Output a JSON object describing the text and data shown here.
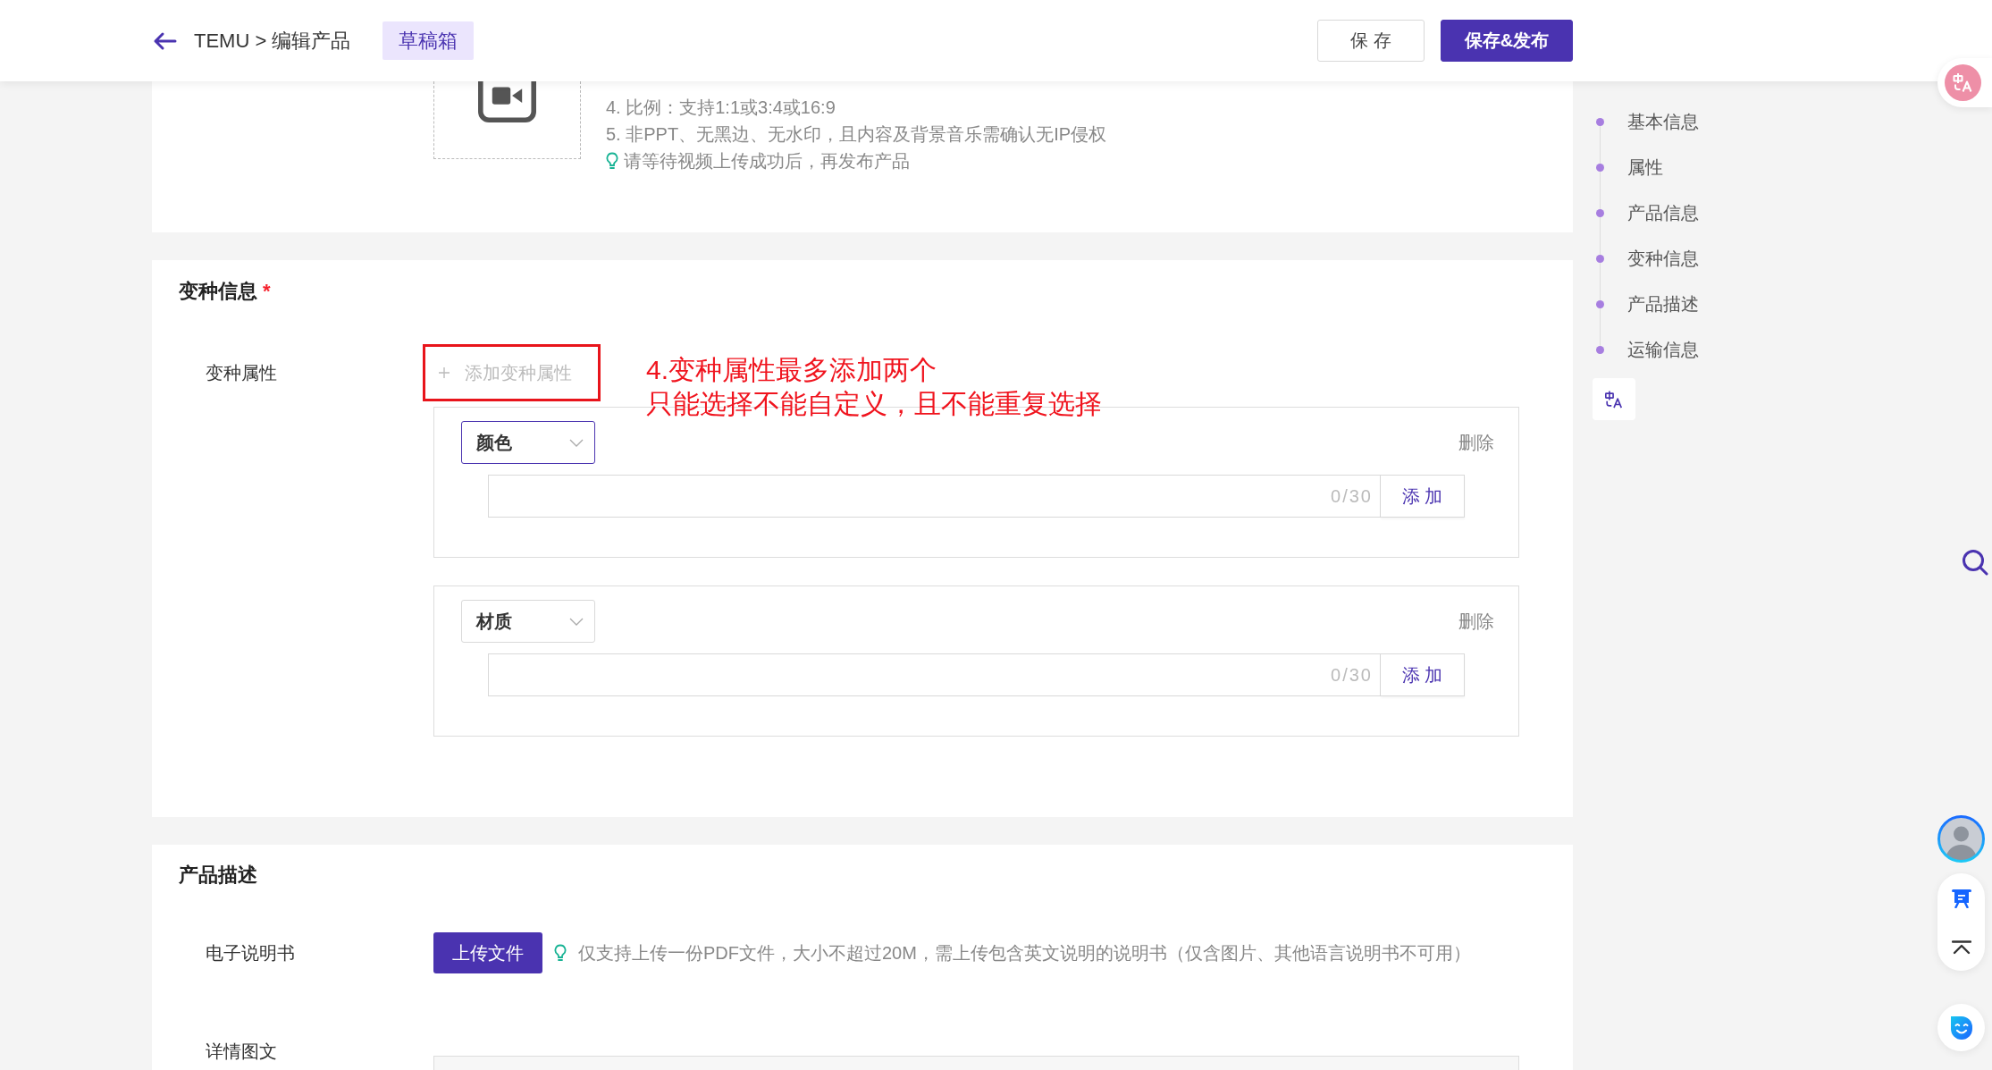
{
  "header": {
    "breadcrumb": "TEMU > 编辑产品",
    "badge": "草稿箱",
    "buttons": [
      {
        "label": "保 存",
        "kind": "secondary"
      },
      {
        "label": "保存&发布",
        "kind": "primary"
      }
    ]
  },
  "video_section": {
    "requirements": [
      "4. 比例：支持1:1或3:4或16:9",
      "5. 非PPT、无黑边、无水印，且内容及背景音乐需确认无IP侵权"
    ],
    "tip": "请等待视频上传成功后，再发布产品"
  },
  "variant_section": {
    "title": "变种信息",
    "required_mark": "*",
    "field_label": "变种属性",
    "add_button": "添加变种属性",
    "annotation": [
      "4.变种属性最多添加两个",
      "只能选择不能自定义，且不能重复选择"
    ],
    "variants": [
      {
        "attribute": "颜色",
        "focused": true,
        "delete": "删除",
        "counter": "0/30",
        "add_button": "添 加"
      },
      {
        "attribute": "材质",
        "focused": false,
        "delete": "删除",
        "counter": "0/30",
        "add_button": "添 加"
      }
    ]
  },
  "description_section": {
    "title": "产品描述",
    "manual_label": "电子说明书",
    "upload_button": "上传文件",
    "upload_tip": "仅支持上传一份PDF文件，大小不超过20M，需上传包含英文说明的说明书（仅含图片、其他语言说明书不可用）",
    "detail_label": "详情图文"
  },
  "side_nav": {
    "items": [
      {
        "label": "基本信息"
      },
      {
        "label": "属性"
      },
      {
        "label": "产品信息"
      },
      {
        "label": "变种信息"
      },
      {
        "label": "产品描述"
      },
      {
        "label": "运输信息"
      }
    ]
  }
}
